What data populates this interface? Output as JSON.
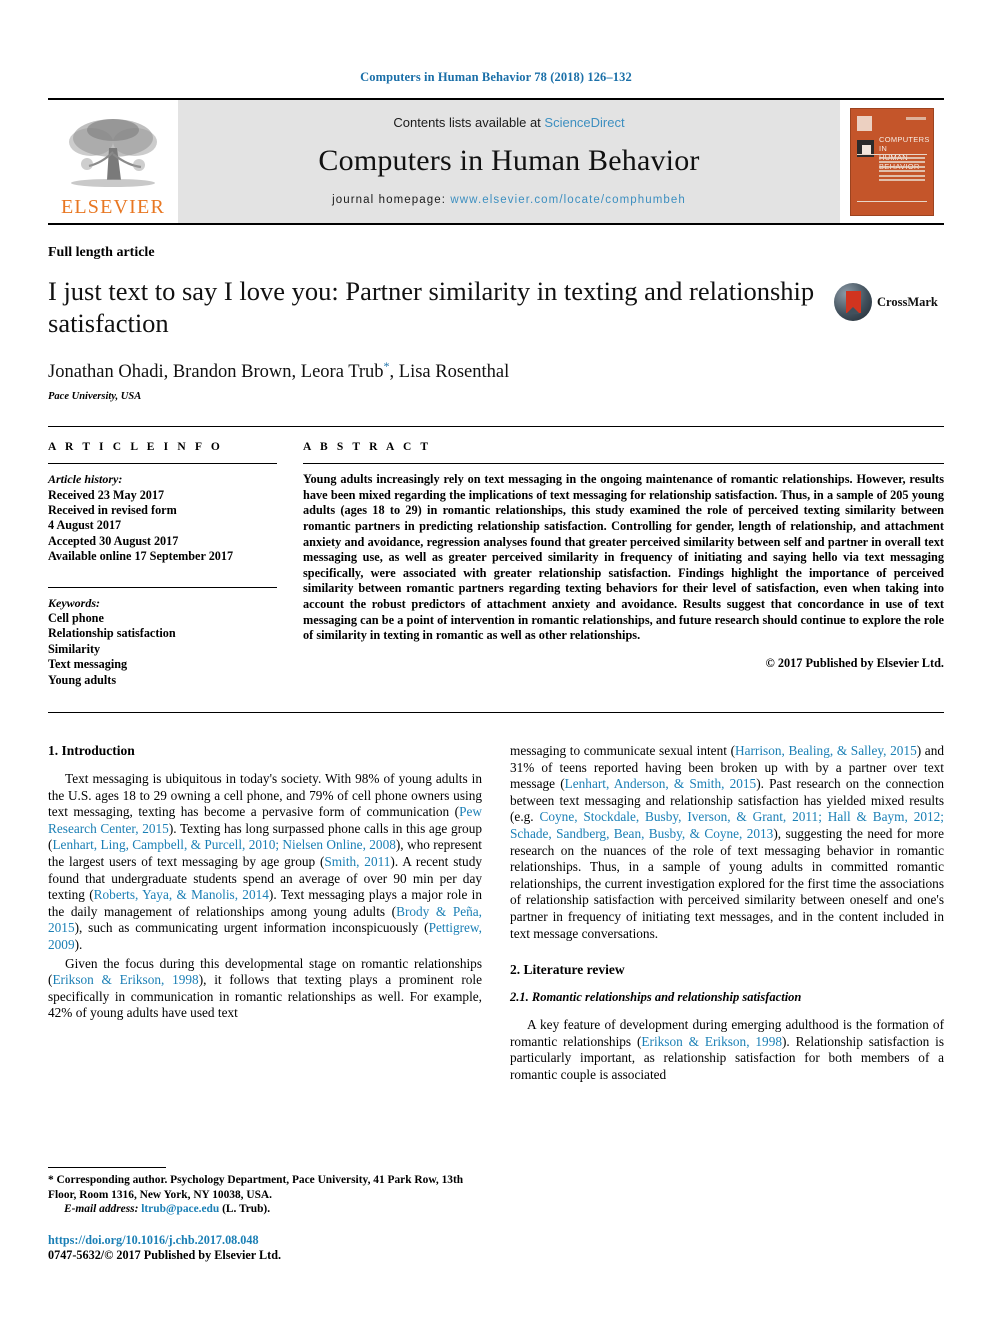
{
  "running_head": "Computers in Human Behavior 78 (2018) 126–132",
  "masthead": {
    "publisher_name": "ELSEVIER",
    "contents_prefix": "Contents lists available at ",
    "sciencedirect": "ScienceDirect",
    "journal_title": "Computers in Human Behavior",
    "homepage_prefix": "journal homepage: ",
    "homepage_url": "www.elsevier.com/locate/comphumbeh",
    "cover_title_line1": "COMPUTERS IN",
    "cover_title_line2": "HUMAN BEHAVIOR"
  },
  "article": {
    "type": "Full length article",
    "title": "I just text to say I love you: Partner similarity in texting and relationship satisfaction",
    "authors": "Jonathan Ohadi, Brandon Brown, Leora Trub",
    "authors_tail": ", Lisa Rosenthal",
    "corresponding_marker": "*",
    "affiliation": "Pace University, USA",
    "crossmark_label": "CrossMark"
  },
  "info": {
    "heading": "A R T I C L E   I N F O",
    "history_label": "Article history:",
    "history": [
      "Received 23 May 2017",
      "Received in revised form",
      "4 August 2017",
      "Accepted 30 August 2017",
      "Available online 17 September 2017"
    ],
    "keywords_label": "Keywords:",
    "keywords": [
      "Cell phone",
      "Relationship satisfaction",
      "Similarity",
      "Text messaging",
      "Young adults"
    ]
  },
  "abstract": {
    "heading": "A B S T R A C T",
    "text": "Young adults increasingly rely on text messaging in the ongoing maintenance of romantic relationships. However, results have been mixed regarding the implications of text messaging for relationship satisfaction. Thus, in a sample of 205 young adults (ages 18 to 29) in romantic relationships, this study examined the role of perceived texting similarity between romantic partners in predicting relationship satisfaction. Controlling for gender, length of relationship, and attachment anxiety and avoidance, regression analyses found that greater perceived similarity between self and partner in overall text messaging use, as well as greater perceived similarity in frequency of initiating and saying hello via text messaging specifically, were associated with greater relationship satisfaction. Findings highlight the importance of perceived similarity between romantic partners regarding texting behaviors for their level of satisfaction, even when taking into account the robust predictors of attachment anxiety and avoidance. Results suggest that concordance in use of text messaging can be a point of intervention in romantic relationships, and future research should continue to explore the role of similarity in texting in romantic as well as other relationships.",
    "copyright": "© 2017 Published by Elsevier Ltd."
  },
  "body": {
    "left": {
      "section1_heading": "1. Introduction",
      "p1_a": "Text messaging is ubiquitous in today's society. With 98% of young adults in the U.S. ages 18 to 29 owning a cell phone, and 79% of cell phone owners using text messaging, texting has become a pervasive form of communication (",
      "p1_cite1": "Pew Research Center, 2015",
      "p1_b": "). Texting has long surpassed phone calls in this age group (",
      "p1_cite2": "Lenhart, Ling, Campbell, & Purcell, 2010; Nielsen Online, 2008",
      "p1_c": "), who represent the largest users of text messaging by age group (",
      "p1_cite3": "Smith, 2011",
      "p1_d": "). A recent study found that undergraduate students spend an average of over 90 min per day texting (",
      "p1_cite4": "Roberts, Yaya, & Manolis, 2014",
      "p1_e": "). Text messaging plays a major role in the daily management of relationships among young adults (",
      "p1_cite5": "Brody & Peña, 2015",
      "p1_f": "), such as communicating urgent information inconspicuously (",
      "p1_cite6": "Pettigrew, 2009",
      "p1_g": ").",
      "p2_a": "Given the focus during this developmental stage on romantic relationships (",
      "p2_cite1": "Erikson & Erikson, 1998",
      "p2_b": "), it follows that texting plays a prominent role specifically in communication in romantic relationships as well. For example, 42% of young adults have used text"
    },
    "right": {
      "p1_a": "messaging to communicate sexual intent (",
      "p1_cite1": "Harrison, Bealing, & Salley, 2015",
      "p1_b": ") and 31% of teens reported having been broken up with by a partner over text message (",
      "p1_cite2": "Lenhart, Anderson, & Smith, 2015",
      "p1_c": "). Past research on the connection between text messaging and relationship satisfaction has yielded mixed results (e.g. ",
      "p1_cite3": "Coyne, Stockdale, Busby, Iverson, & Grant, 2011; Hall & Baym, 2012; Schade, Sandberg, Bean, Busby, & Coyne, 2013",
      "p1_d": "), suggesting the need for more research on the nuances of the role of text messaging behavior in romantic relationships. Thus, in a sample of young adults in committed romantic relationships, the current investigation explored for the first time the associations of relationship satisfaction with perceived similarity between oneself and one's partner in frequency of initiating text messages, and in the content included in text message conversations.",
      "section2_heading": "2. Literature review",
      "subsection_heading": "2.1. Romantic relationships and relationship satisfaction",
      "p2_a": "A key feature of development during emerging adulthood is the formation of romantic relationships (",
      "p2_cite1": "Erikson & Erikson, 1998",
      "p2_b": "). Relationship satisfaction is particularly important, as relationship satisfaction for both members of a romantic couple is associated"
    }
  },
  "footnotes": {
    "corresponding_marker": "*",
    "corresponding": " Corresponding author. Psychology Department, Pace University, 41 Park Row, 13th Floor, Room 1316, New York, NY 10038, USA.",
    "email_label": "E-mail address:",
    "email": "ltrub@pace.edu",
    "email_owner": "(L. Trub).",
    "doi": "https://doi.org/10.1016/j.chb.2017.08.048",
    "issn": "0747-5632/© 2017 Published by Elsevier Ltd."
  },
  "colors": {
    "link_blue": "#1a7fb5",
    "header_blue": "#1a6fa8",
    "sciencedirect_blue": "#3d8fc0",
    "elsevier_orange": "#e87722",
    "cover_rust": "#c4552a"
  }
}
